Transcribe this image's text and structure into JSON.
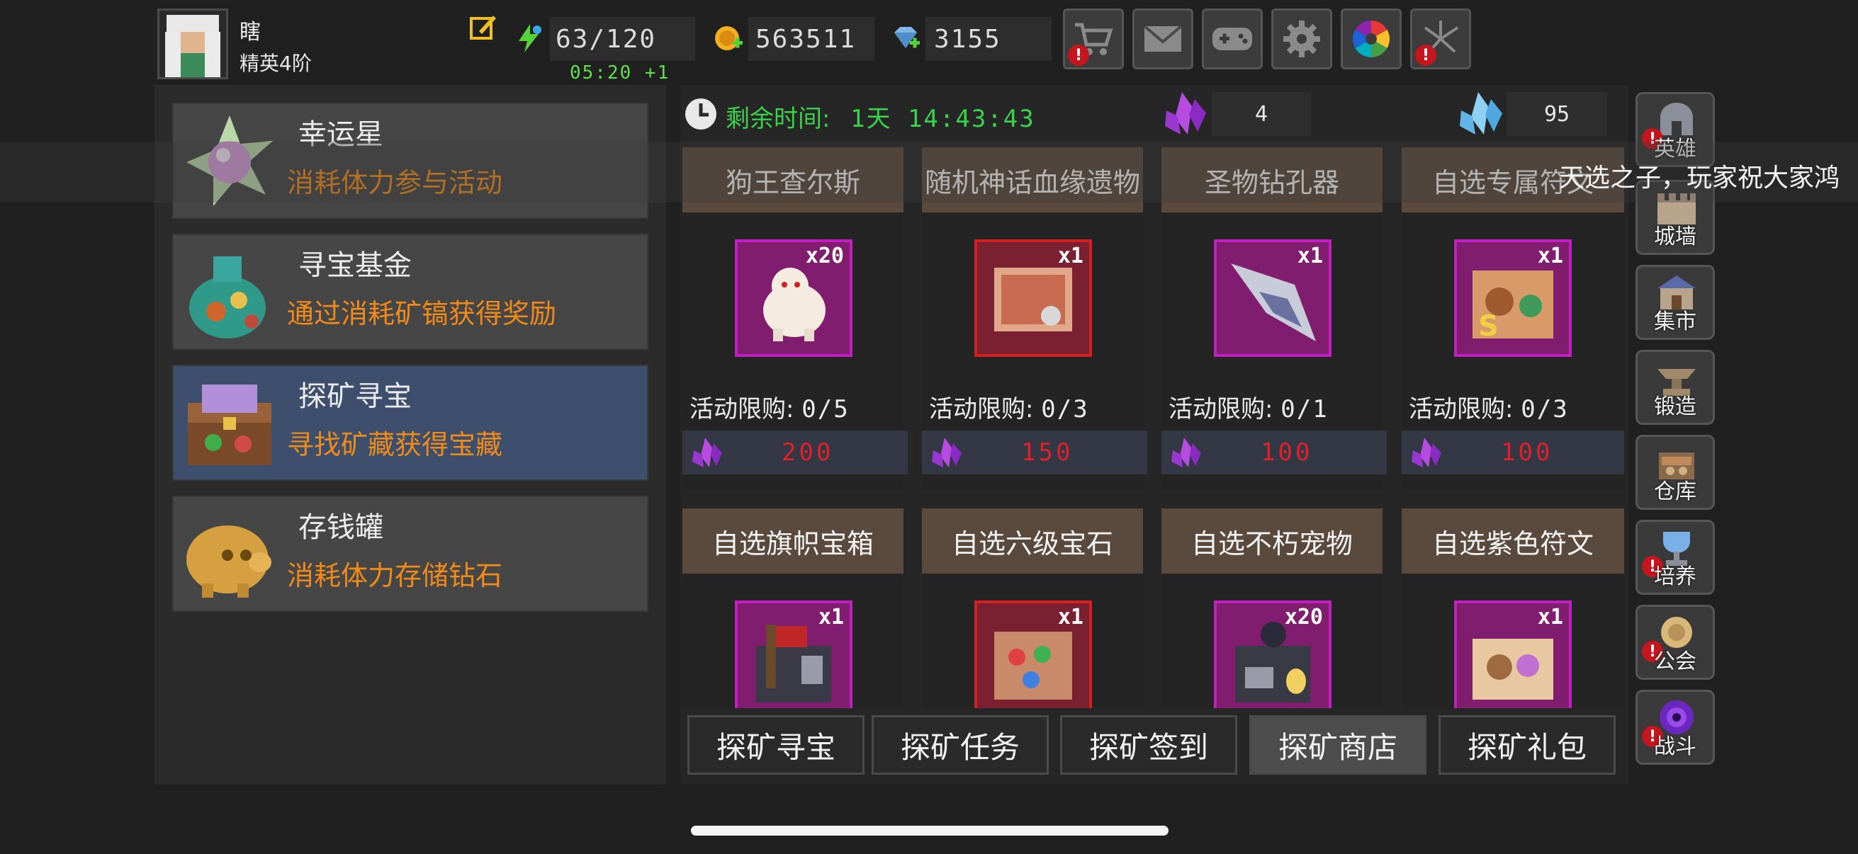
{
  "player": {
    "name": "瞎",
    "rank": "精英4阶"
  },
  "resources": {
    "stamina": "63/120",
    "stamina_timer": "05:20 +1",
    "gold": "563511",
    "diamonds": "3155"
  },
  "top_buttons": [
    {
      "icon": "cart-icon",
      "alert": true
    },
    {
      "icon": "mail-icon",
      "alert": false
    },
    {
      "icon": "gamepad-icon",
      "alert": false
    },
    {
      "icon": "gear-icon",
      "alert": false
    },
    {
      "icon": "color-wheel-icon",
      "alert": false
    },
    {
      "icon": "firework-icon",
      "alert": true
    }
  ],
  "events": [
    {
      "title": "幸运星",
      "desc": "消耗体力参与活动",
      "icon": "lucky-star-icon"
    },
    {
      "title": "寻宝基金",
      "desc": "通过消耗矿镐获得奖励",
      "icon": "treasure-bag-icon"
    },
    {
      "title": "探矿寻宝",
      "desc": "寻找矿藏获得宝藏",
      "icon": "treasure-chest-icon",
      "active": true
    },
    {
      "title": "存钱罐",
      "desc": "消耗体力存储钻石",
      "icon": "piggy-bank-icon"
    }
  ],
  "shop": {
    "remain_label": "剩余时间:",
    "remain_value": "1天 14:43:43",
    "purple_crystal_count": "4",
    "blue_crystal_count": "95",
    "items": [
      {
        "name": "狗王查尔斯",
        "qty": "x20",
        "limit_label": "活动限购:",
        "limit": "0/5",
        "price": "200",
        "frame": "purple"
      },
      {
        "name": "随机神话血缘遗物",
        "qty": "x1",
        "limit_label": "活动限购:",
        "limit": "0/3",
        "price": "150",
        "frame": "red"
      },
      {
        "name": "圣物钻孔器",
        "qty": "x1",
        "limit_label": "活动限购:",
        "limit": "0/1",
        "price": "100",
        "frame": "purple"
      },
      {
        "name": "自选专属符文",
        "qty": "x1",
        "limit_label": "活动限购:",
        "limit": "0/3",
        "price": "100",
        "frame": "purple"
      },
      {
        "name": "自选旗帜宝箱",
        "qty": "x1",
        "frame": "purple"
      },
      {
        "name": "自选六级宝石",
        "qty": "x1",
        "frame": "red"
      },
      {
        "name": "自选不朽宠物",
        "qty": "x20",
        "frame": "purple"
      },
      {
        "name": "自选紫色符文",
        "qty": "x1",
        "frame": "purple"
      }
    ]
  },
  "tabs": [
    "探矿寻宝",
    "探矿任务",
    "探矿签到",
    "探矿商店",
    "探矿礼包"
  ],
  "active_tab": "探矿商店",
  "side_nav": [
    {
      "label": "英雄",
      "alert": true
    },
    {
      "label": "城墙",
      "alert": false
    },
    {
      "label": "集市",
      "alert": false
    },
    {
      "label": "锻造",
      "alert": false
    },
    {
      "label": "仓库",
      "alert": false
    },
    {
      "label": "培养",
      "alert": true
    },
    {
      "label": "公会",
      "alert": true
    },
    {
      "label": "战斗",
      "alert": true
    }
  ],
  "marquee": "天选之子，玩家祝大家鸿",
  "colors": {
    "accent_orange": "#f08a1a",
    "timer_green": "#39d34a",
    "price_red": "#e0202a",
    "active_event_bg": "#3d4f6c",
    "purple_frame": "#c21fc3",
    "red_frame": "#d62020"
  }
}
